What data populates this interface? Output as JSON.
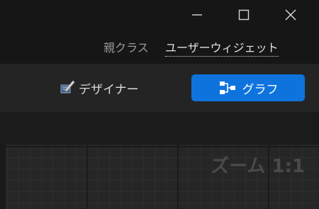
{
  "window": {
    "controls": {
      "minimize_icon": "minimize-icon",
      "maximize_icon": "maximize-icon",
      "close_icon": "close-icon"
    }
  },
  "parent_class": {
    "label": "親クラス",
    "value": "ユーザーウィジェット"
  },
  "mode_toolbar": {
    "designer": {
      "label": "デザイナー",
      "icon": "designer-pencil-icon"
    },
    "graph": {
      "label": "グラフ",
      "icon": "graph-nodes-icon",
      "active": true
    }
  },
  "graph_canvas": {
    "zoom_label": "ズーム 1:1"
  },
  "colors": {
    "accent": "#0f73de",
    "background": "#131313",
    "toolbar": "#242424",
    "canvas": "#262626"
  }
}
